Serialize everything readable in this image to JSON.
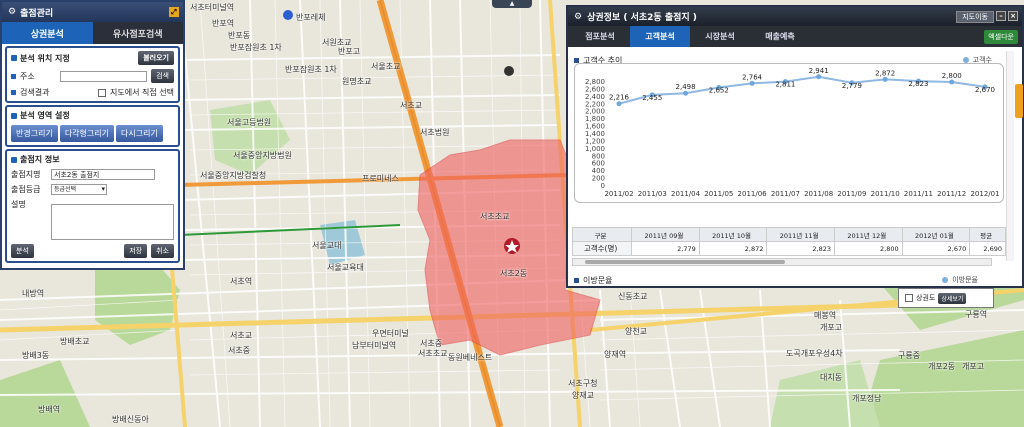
{
  "map": {
    "labels": [
      {
        "text": "서초역",
        "x": 230,
        "y": 276
      },
      {
        "text": "반포레체",
        "x": 296,
        "y": 12
      },
      {
        "text": "서원초교",
        "x": 322,
        "y": 37
      },
      {
        "text": "반포고",
        "x": 338,
        "y": 46
      },
      {
        "text": "서울초교",
        "x": 371,
        "y": 61
      },
      {
        "text": "원명초교",
        "x": 342,
        "y": 76
      },
      {
        "text": "반포잠원초 1차",
        "x": 230,
        "y": 46
      },
      {
        "text": "반포잠원초 1차",
        "x": 285,
        "y": 68
      },
      {
        "text": "서울고등법원",
        "x": 227,
        "y": 117
      },
      {
        "text": "서울중앙지방법원",
        "x": 233,
        "y": 153
      },
      {
        "text": "서울중앙지방검찰청",
        "x": 217,
        "y": 173
      },
      {
        "text": "서울교대",
        "x": 312,
        "y": 240
      },
      {
        "text": "서울교육대",
        "x": 327,
        "y": 265
      },
      {
        "text": "서초교",
        "x": 230,
        "y": 332
      },
      {
        "text": "서초중",
        "x": 228,
        "y": 350
      },
      {
        "text": "남부터미널역",
        "x": 352,
        "y": 345
      },
      {
        "text": "서초초교",
        "x": 418,
        "y": 352
      },
      {
        "text": "동원베네스트",
        "x": 458,
        "y": 355
      },
      {
        "text": "서초구청",
        "x": 572,
        "y": 380
      },
      {
        "text": "양재역",
        "x": 604,
        "y": 353
      },
      {
        "text": "우면터미널",
        "x": 378,
        "y": 333
      },
      {
        "text": "서초2동",
        "x": 512,
        "y": 270
      },
      {
        "text": "서초초교",
        "x": 492,
        "y": 213
      },
      {
        "text": "프로미네스",
        "x": 366,
        "y": 178
      },
      {
        "text": "서초법원",
        "x": 420,
        "y": 130
      },
      {
        "text": "서초교",
        "x": 406,
        "y": 103
      },
      {
        "text": "신동초교",
        "x": 620,
        "y": 293
      },
      {
        "text": "양천교",
        "x": 625,
        "y": 330
      },
      {
        "text": "매봉역",
        "x": 814,
        "y": 316
      },
      {
        "text": "개포고",
        "x": 820,
        "y": 326
      },
      {
        "text": "도곡개포우성4차",
        "x": 792,
        "y": 352
      },
      {
        "text": "대치동",
        "x": 820,
        "y": 376
      },
      {
        "text": "개포정남",
        "x": 858,
        "y": 396
      },
      {
        "text": "구룡역",
        "x": 965,
        "y": 313
      },
      {
        "text": "구룡중",
        "x": 898,
        "y": 354
      },
      {
        "text": "개포2동",
        "x": 928,
        "y": 365
      },
      {
        "text": "개포고",
        "x": 962,
        "y": 365
      },
      {
        "text": "방배초교",
        "x": 60,
        "y": 339
      },
      {
        "text": "방배3동",
        "x": 30,
        "y": 353
      },
      {
        "text": "방배역",
        "x": 38,
        "y": 408
      },
      {
        "text": "방배신동아",
        "x": 120,
        "y": 418
      },
      {
        "text": "내방역",
        "x": 22,
        "y": 291
      },
      {
        "text": "서초터미널역",
        "x": 180,
        "y": 6
      },
      {
        "text": "반포역",
        "x": 215,
        "y": 20
      },
      {
        "text": "반포동",
        "x": 235,
        "y": 33
      },
      {
        "text": "양재교",
        "x": 572,
        "y": 392
      },
      {
        "text": "서초중",
        "x": 428,
        "y": 345
      }
    ],
    "subway_labels": [
      "서초역",
      "교대역",
      "강남역"
    ]
  },
  "left_panel": {
    "title": "출점관리",
    "tabs": [
      "상권분석",
      "유사점포검색"
    ],
    "analysis_location": {
      "header": "분석 위치 지정",
      "btn_load": "불러오기",
      "address_label": "주소",
      "btn_search": "검색",
      "result_label": "검색결과",
      "map_select_label": "지도에서 직접 선택"
    },
    "area_setting": {
      "header": "분석 영역 설정",
      "btn_radius": "반경그리기",
      "btn_polygon": "다각형그리기",
      "btn_redraw": "다시그리기"
    },
    "store_info": {
      "header": "출점지 정보",
      "name_label": "출점지명",
      "name_value": "서초2동 출점지",
      "grade_label": "출점등급",
      "grade_value": "등급선택",
      "desc_label": "설명",
      "btn_analyze": "분석",
      "btn_save": "저장",
      "btn_cancel": "취소"
    }
  },
  "right_panel": {
    "title": "상권정보 ( 서초2동 출점지 )",
    "toggle_label": "지도이동",
    "tabs": [
      "점포분석",
      "고객분석",
      "시장분석",
      "매출예측"
    ],
    "excel_label": "엑셀다운",
    "section_title": "고객수 추이",
    "legend_label": "고객수",
    "grid": {
      "headers": [
        "구분",
        "2011년 09월",
        "2011년 10월",
        "2011년 11월",
        "2011년 12월",
        "2012년 01월",
        "평균"
      ],
      "row_label": "고객수(명)",
      "values": [
        "2,779",
        "2,872",
        "2,823",
        "2,800",
        "2,670",
        "2,690"
      ]
    },
    "next_section": "이방문율",
    "next_legend": "이방문율"
  },
  "mini_panel": {
    "label": "상권도",
    "btn": "상세보기"
  },
  "chart_data": {
    "type": "line",
    "categories": [
      "2011/02",
      "2011/03",
      "2011/04",
      "2011/05",
      "2011/06",
      "2011/07",
      "2011/08",
      "2011/09",
      "2011/10",
      "2011/11",
      "2011/12",
      "2012/01"
    ],
    "series": [
      {
        "name": "고객수",
        "values": [
          2216,
          2455,
          2498,
          2652,
          2764,
          2811,
          2941,
          2779,
          2872,
          2823,
          2800,
          2670
        ]
      }
    ],
    "data_labels": [
      "2,216",
      "2,455",
      "2,498",
      "2,652",
      "2,764",
      "2,811",
      "2,941",
      "2,779",
      "2,872",
      "2,823",
      "2,800",
      "2,670"
    ],
    "ylim": [
      0,
      2800
    ],
    "yticks": [
      "0",
      "200",
      "400",
      "600",
      "800",
      "1,000",
      "1,200",
      "1,400",
      "1,600",
      "1,800",
      "2,000",
      "2,200",
      "2,400",
      "2,600",
      "2,800"
    ],
    "line_color": "#8fb8e2",
    "grid": false
  }
}
